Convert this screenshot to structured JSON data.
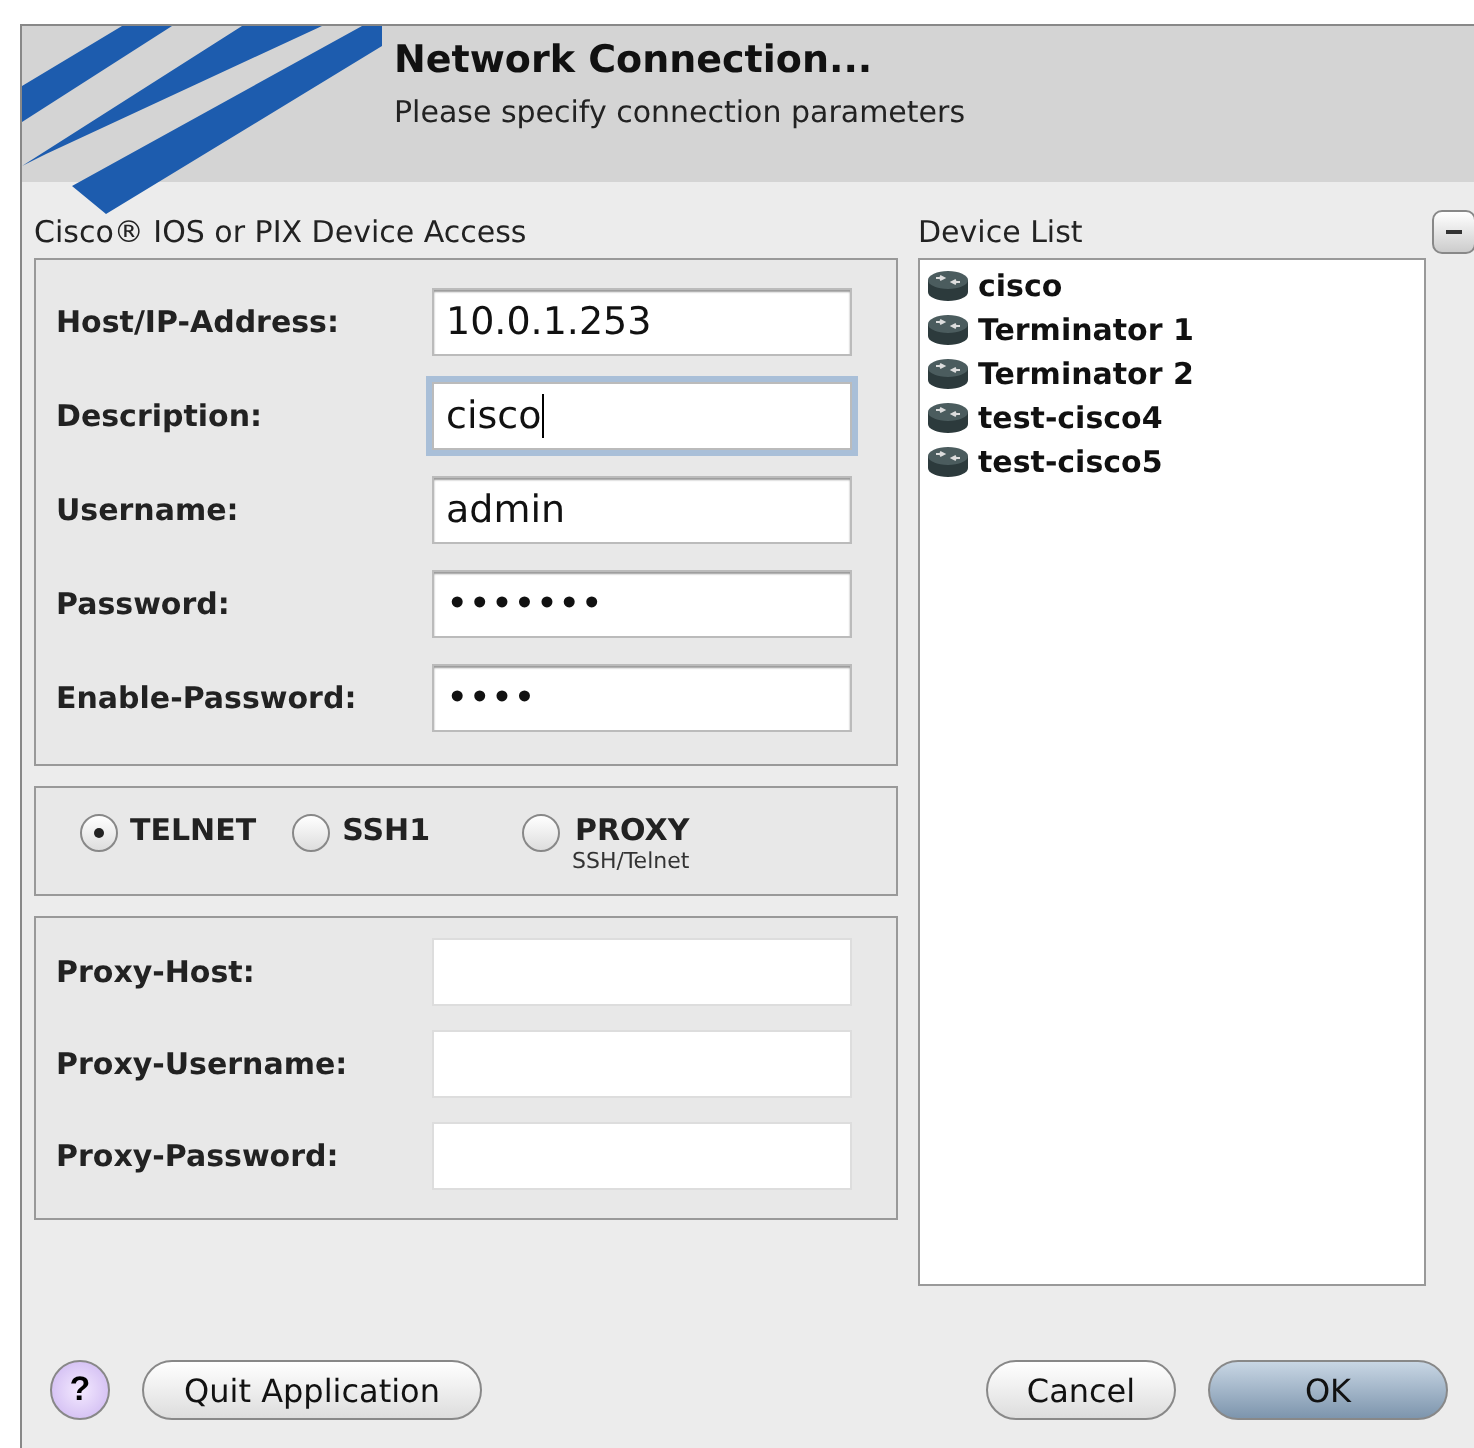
{
  "header": {
    "title": "Network Connection...",
    "subtitle": "Please specify connection parameters"
  },
  "access": {
    "title": "Cisco® IOS or PIX Device Access",
    "fields": [
      {
        "label": "Host/IP-Address:",
        "value": "10.0.1.253",
        "focused": false
      },
      {
        "label": "Description:",
        "value": "cisco",
        "focused": true
      },
      {
        "label": "Username:",
        "value": "admin",
        "focused": false
      },
      {
        "label": "Password:",
        "value": "•••••••",
        "focused": false
      },
      {
        "label": "Enable-Password:",
        "value": "••••",
        "focused": false
      }
    ],
    "protocols": [
      {
        "label": "TELNET",
        "selected": true
      },
      {
        "label": "SSH1",
        "selected": false
      },
      {
        "label": "PROXY",
        "sublabel": "SSH/Telnet",
        "selected": false
      }
    ],
    "proxy_fields": [
      {
        "label": "Proxy-Host:"
      },
      {
        "label": "Proxy-Username:"
      },
      {
        "label": "Proxy-Password:"
      }
    ]
  },
  "device_list": {
    "title": "Device List",
    "items": [
      {
        "name": "cisco"
      },
      {
        "name": "Terminator 1"
      },
      {
        "name": "Terminator 2"
      },
      {
        "name": "test-cisco4"
      },
      {
        "name": "test-cisco5"
      }
    ]
  },
  "footer": {
    "help": "?",
    "quit": "Quit Application",
    "cancel": "Cancel",
    "ok": "OK"
  }
}
